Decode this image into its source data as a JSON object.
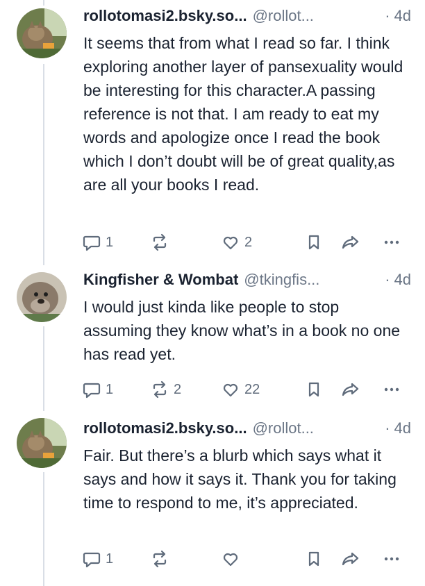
{
  "posts": [
    {
      "display_name": "rollotomasi2.bsky.so...",
      "handle": "@rollot...",
      "separator": "·",
      "time": "4d",
      "text": "It seems that from what I read so far. I think exploring another layer of pansexuality would be interesting for this character.A passing reference is not that. I am ready to eat my words and apologize once I read the book which I don’t doubt will be of great quality,as are all your books I read.",
      "reply_count": "1",
      "repost_count": "",
      "like_count": "2"
    },
    {
      "display_name": "Kingfisher & Wombat",
      "handle": "@tkingfis...",
      "separator": "·",
      "time": "4d",
      "text": "I would just kinda like people to stop assuming they know what’s in a book no one has read yet.",
      "reply_count": "1",
      "repost_count": "2",
      "like_count": "22"
    },
    {
      "display_name": "rollotomasi2.bsky.so...",
      "handle": "@rollot...",
      "separator": "·",
      "time": "4d",
      "text": "Fair. But there’s a blurb which says what it says and how it says it. Thank you for taking time to respond to me, it’s appreciated.",
      "reply_count": "1",
      "repost_count": "",
      "like_count": ""
    }
  ],
  "icons": {
    "reply": "reply-icon",
    "repost": "repost-icon",
    "like": "like-icon",
    "bookmark": "bookmark-icon",
    "share": "share-icon",
    "more": "more-icon"
  },
  "colors": {
    "text": "#1a2230",
    "muted": "#6b7686",
    "thread_line": "#d9dee6"
  }
}
